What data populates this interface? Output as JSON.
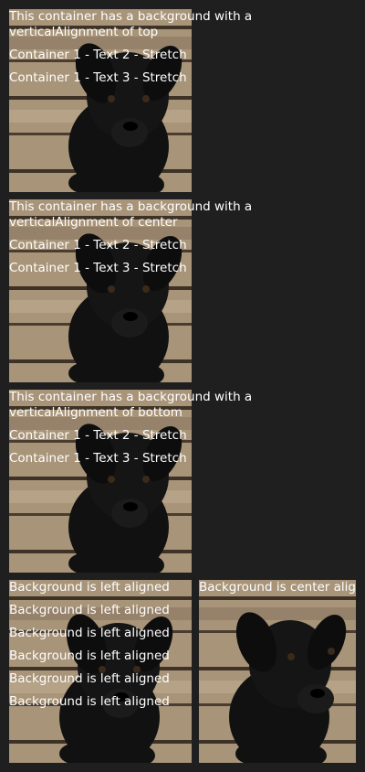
{
  "containers": [
    {
      "title": "This container has a background with a verticalAlignment of top",
      "text2": "Container 1 - Text 2 - Stretch",
      "text3": "Container 1 - Text 3 - Stretch"
    },
    {
      "title": "This container has a background with a verticalAlignment of center",
      "text2": "Container 1 - Text 2 - Stretch",
      "text3": "Container 1 - Text 3 - Stretch"
    },
    {
      "title": "This container has a background with a verticalAlignment of bottom",
      "text2": "Container 1 - Text 2 - Stretch",
      "text3": "Container 1 - Text 3 - Stretch"
    }
  ],
  "left_column": {
    "lines": [
      "Background is left aligned",
      "Background is left aligned",
      "Background is left aligned",
      "Background is left aligned",
      "Background is left aligned",
      "Background is left aligned"
    ]
  },
  "right_column": {
    "line": "Background is center aligned"
  },
  "colors": {
    "page_background": "#1f1f1f",
    "text": "#ffffff",
    "wood_light": "#a89478",
    "wood_dark": "#5a4a38"
  }
}
